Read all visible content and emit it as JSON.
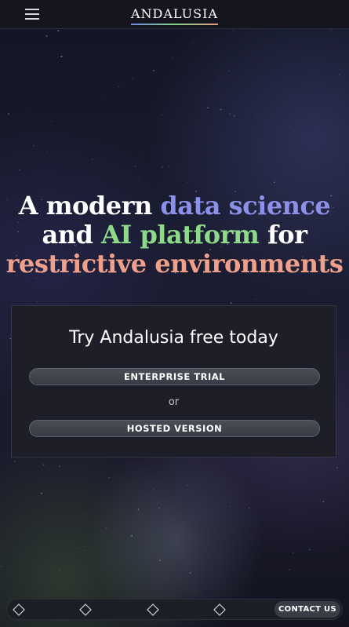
{
  "header": {
    "menu_icon": "hamburger-menu-icon",
    "logo": "ANDALUSIA"
  },
  "hero": {
    "line1_plain": "A modern ",
    "line1_accent": "data science",
    "line2_plain_start": "and ",
    "line2_accent": "AI platform",
    "line2_plain_end": " for",
    "line3_accent": "restrictive environments"
  },
  "trial_card": {
    "title": "Try Andalusia free today",
    "enterprise_button": "ENTERPRISE TRIAL",
    "separator": "or",
    "hosted_button": "HOSTED VERSION"
  },
  "bottom_bar": {
    "icons": [
      "diamond-icon",
      "diamond-icon",
      "diamond-icon",
      "diamond-icon"
    ],
    "contact_button": "CONTACT US"
  },
  "colors": {
    "accent_blue": "#8b91e8",
    "accent_green": "#8ed98a",
    "accent_salmon": "#f0a08a",
    "background": "#11121c"
  }
}
